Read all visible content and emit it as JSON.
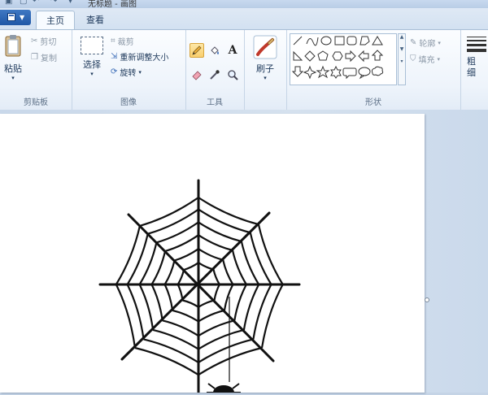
{
  "window": {
    "title": "无标题 - 画图"
  },
  "tabs": [
    {
      "label": "主页",
      "active": true
    },
    {
      "label": "查看",
      "active": false
    }
  ],
  "clipboard": {
    "paste_label": "粘贴",
    "cut_label": "剪切",
    "copy_label": "复制",
    "group_label": "剪贴板"
  },
  "image": {
    "select_label": "选择",
    "crop_label": "裁剪",
    "resize_label": "重新调整大小",
    "rotate_label": "旋转",
    "group_label": "图像"
  },
  "tools": {
    "group_label": "工具",
    "selected_tool": "pencil",
    "text_tool_glyph": "A"
  },
  "brushes": {
    "label": "刷子"
  },
  "shapes": {
    "outline_label": "轮廓",
    "fill_label": "填充",
    "group_label": "形状"
  },
  "size": {
    "label": "粗细"
  },
  "colors": {
    "selection": "#f9cf6e",
    "accent": "#1f57a6",
    "canvas": "#ffffff"
  },
  "canvas": {
    "drawing": "spider-web-with-hanging-spider"
  }
}
